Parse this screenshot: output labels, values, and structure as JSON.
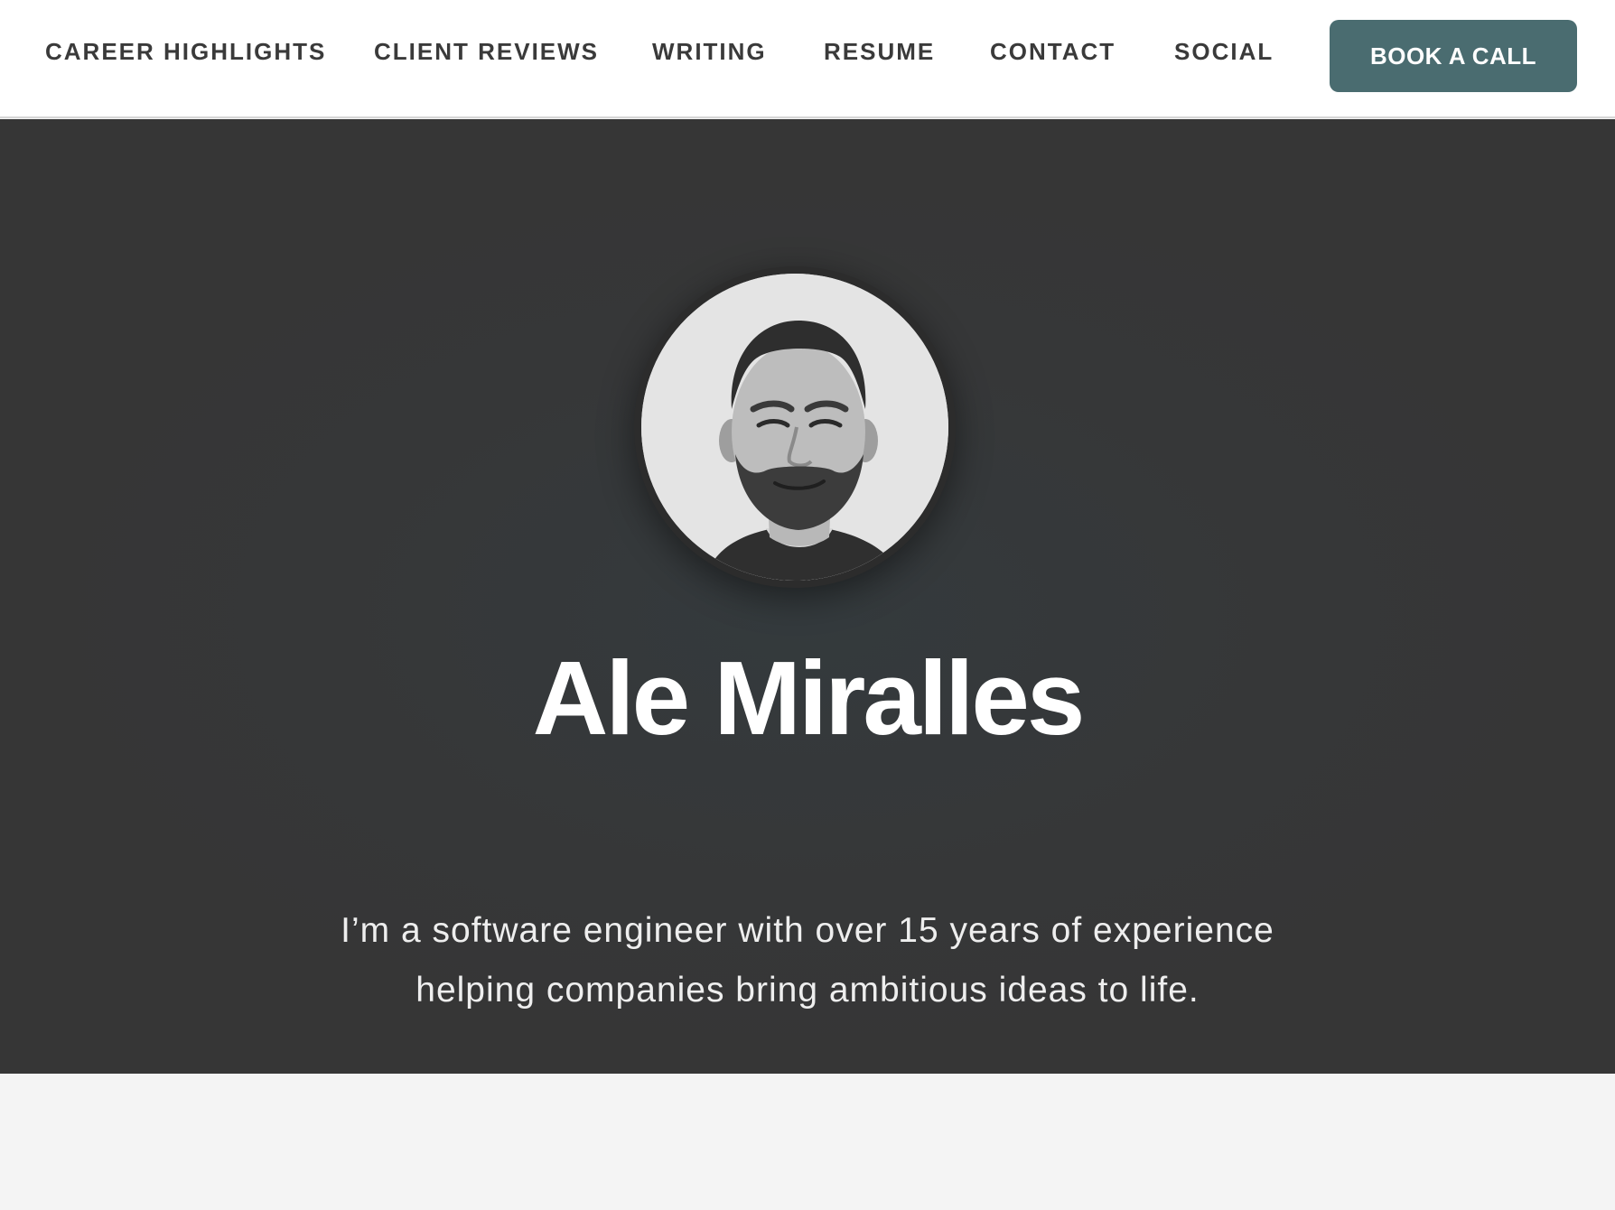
{
  "nav": {
    "links": [
      {
        "label": "CAREER HIGHLIGHTS"
      },
      {
        "label": "CLIENT REVIEWS"
      },
      {
        "label": "WRITING"
      },
      {
        "label": "RESUME"
      },
      {
        "label": "CONTACT"
      },
      {
        "label": "SOCIAL"
      }
    ],
    "cta_label": "BOOK A CALL"
  },
  "hero": {
    "avatar_icon": "profile-photo",
    "name": "Ale Miralles",
    "tagline_line1": "I’m a software engineer with over 15 years of experience",
    "tagline_line2": "helping companies bring ambitious ideas to life."
  },
  "colors": {
    "nav_background": "#ffffff",
    "nav_text": "#3a3a3a",
    "cta_background": "#4a6c70",
    "hero_background": "#363636",
    "hero_text": "#ffffff",
    "page_background": "#f4f4f4"
  }
}
